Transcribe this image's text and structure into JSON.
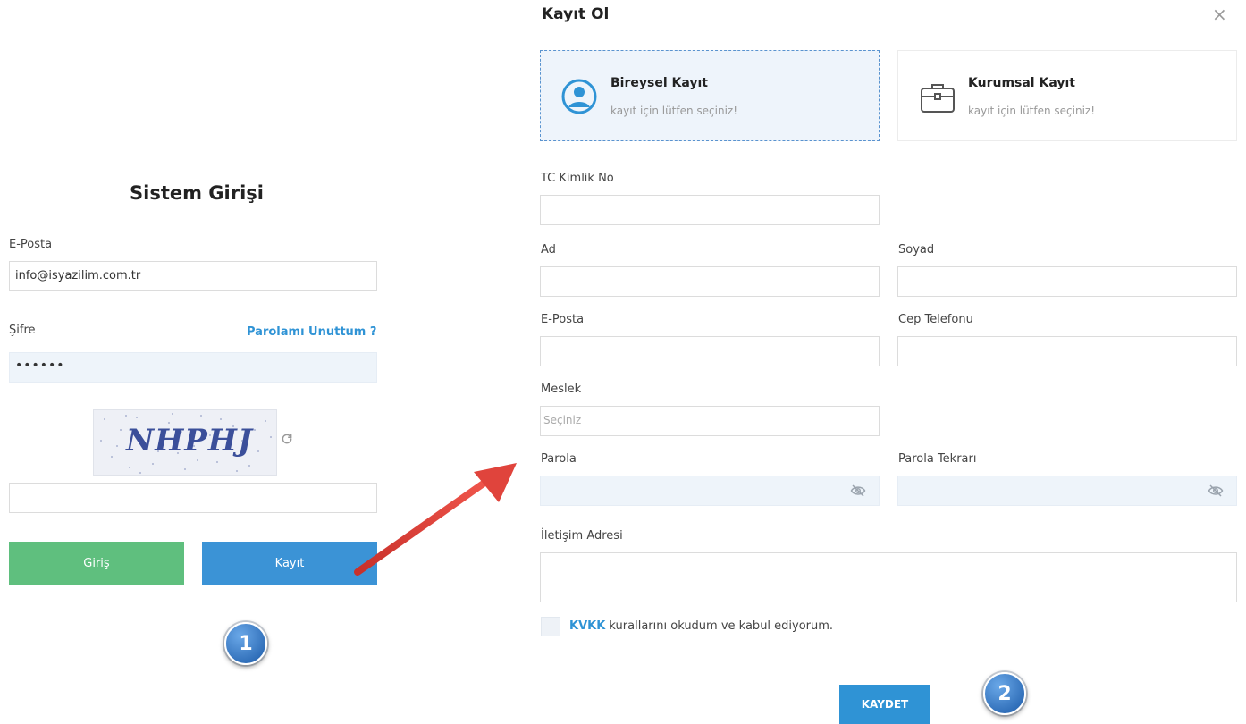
{
  "login": {
    "title": "Sistem Girişi",
    "email_label": "E-Posta",
    "email_value": "info@isyazilim.com.tr",
    "password_label": "Şifre",
    "forgot_link": "Parolamı Unuttum ?",
    "password_masked": "••••••",
    "captcha_text": "NHPHJ",
    "login_button": "Giriş",
    "register_button": "Kayıt"
  },
  "steps": {
    "one": "1",
    "two": "2"
  },
  "modal": {
    "title": "Kayıt Ol",
    "close_glyph": "×",
    "individual": {
      "title": "Bireysel Kayıt",
      "subtitle": "kayıt için lütfen seçiniz!"
    },
    "corporate": {
      "title": "Kurumsal Kayıt",
      "subtitle": "kayıt için lütfen seçiniz!"
    },
    "fields": {
      "tc_label": "TC Kimlik No",
      "first_name_label": "Ad",
      "last_name_label": "Soyad",
      "email_label": "E-Posta",
      "phone_label": "Cep Telefonu",
      "job_label": "Meslek",
      "job_placeholder": "Seçiniz",
      "password_label": "Parola",
      "password_repeat_label": "Parola Tekrarı",
      "address_label": "İletişim Adresi"
    },
    "kvkk_link": "KVKK",
    "kvkk_text": " kurallarını okudum ve kabul ediyorum.",
    "save_button": "KAYDET"
  },
  "colors": {
    "accent_blue": "#2f93d5",
    "login_green": "#5fbf7e",
    "register_blue": "#3b93d6",
    "arrow_red": "#e0443c"
  },
  "icons": {
    "user_circle": "user-circle-icon",
    "briefcase": "briefcase-icon",
    "eye_off": "eye-off-icon",
    "refresh": "refresh-icon",
    "close": "close-icon"
  }
}
